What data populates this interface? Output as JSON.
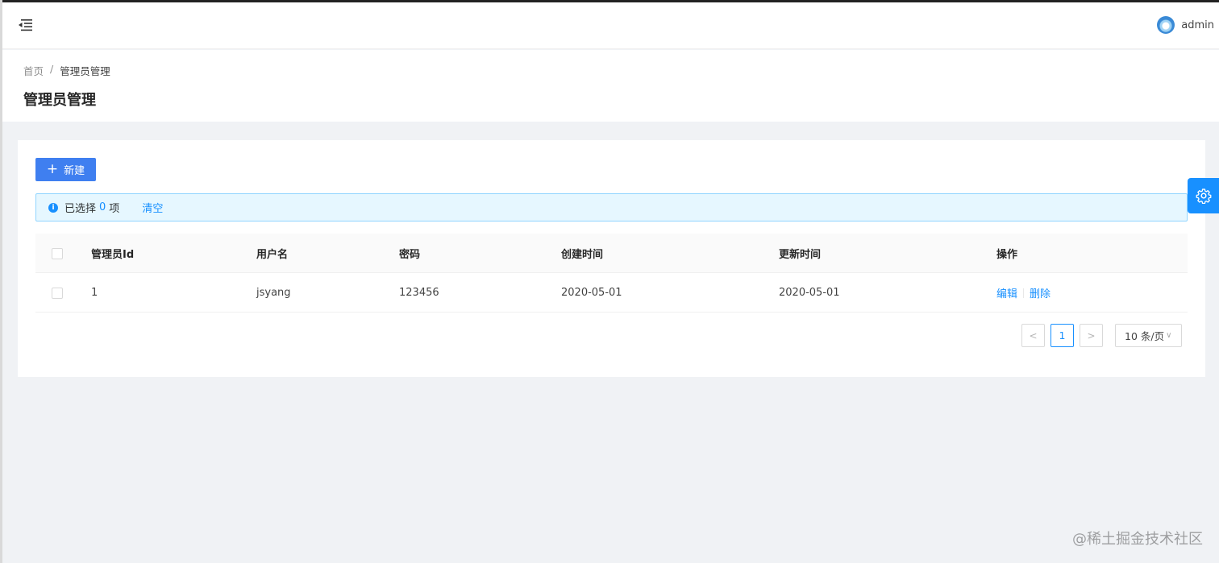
{
  "header": {
    "username": "admin"
  },
  "breadcrumb": {
    "home": "首页",
    "separator": "/",
    "current": "管理员管理"
  },
  "page": {
    "title": "管理员管理"
  },
  "toolbar": {
    "new_icon": "+",
    "new_label": "新建"
  },
  "alert": {
    "prefix": "已选择",
    "count": "0",
    "suffix": "项",
    "clear": "清空"
  },
  "table": {
    "columns": [
      "管理员Id",
      "用户名",
      "密码",
      "创建时间",
      "更新时间",
      "操作"
    ],
    "rows": [
      {
        "id": "1",
        "username": "jsyang",
        "password": "123456",
        "created": "2020-05-01",
        "updated": "2020-05-01",
        "edit": "编辑",
        "delete": "删除"
      }
    ]
  },
  "pagination": {
    "prev": "<",
    "current": "1",
    "next": ">",
    "page_size": "10 条/页",
    "chevron": "∨"
  },
  "watermark": "@稀土掘金技术社区",
  "icons": [
    "menu-fold-icon",
    "avatar",
    "plus-icon",
    "info-icon",
    "gear-icon"
  ],
  "colors": {
    "primary": "#3f7ff0",
    "link": "#1890ff",
    "alert_bg": "#e6f7ff",
    "page_bg": "#f0f2f5"
  }
}
